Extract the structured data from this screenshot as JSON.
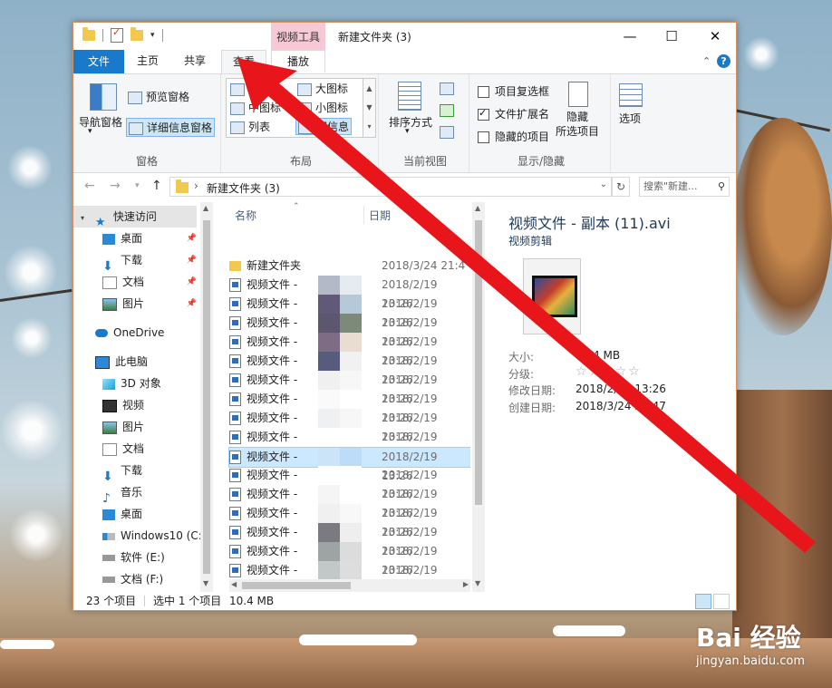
{
  "window": {
    "title": "新建文件夹 (3)",
    "context_tab_header": "视频工具"
  },
  "tabs": [
    {
      "label": "文件"
    },
    {
      "label": "主页"
    },
    {
      "label": "共享"
    },
    {
      "label": "查看"
    },
    {
      "label": "播放"
    }
  ],
  "ribbon": {
    "panes": {
      "nav_pane": "导航窗格",
      "preview_pane": "预览窗格",
      "details_pane": "详细信息窗格",
      "label": "窗格"
    },
    "layout": {
      "items": [
        "超大图标",
        "大图标",
        "中图标",
        "小图标",
        "列表",
        "详细信息"
      ],
      "visible_labels": [
        "超",
        "大图标",
        "中图标",
        "小图标",
        "列表",
        "细信息"
      ],
      "label": "布局"
    },
    "current_view": {
      "sort_by": "排序方式",
      "label": "当前视图"
    },
    "show_hide": {
      "item_checkboxes": "项目复选框",
      "file_extensions": "文件扩展名",
      "hidden_items": "隐藏的项目",
      "hide_selected": "隐藏\n所选项目",
      "hide_selected_1": "隐藏",
      "hide_selected_2": "所选项目",
      "label": "显示/隐藏",
      "file_extensions_checked": true
    },
    "options": "选项"
  },
  "address": {
    "path": "新建文件夹 (3)",
    "search_placeholder": "搜索\"新建..."
  },
  "nav": {
    "quick_access": "快速访问",
    "quick_items": [
      "桌面",
      "下载",
      "文档",
      "图片"
    ],
    "onedrive": "OneDrive",
    "this_pc": "此电脑",
    "pc_items": [
      "3D 对象",
      "视频",
      "图片",
      "文档",
      "下载",
      "音乐",
      "桌面",
      "Windows10 (C:",
      "软件 (E:)",
      "文档 (F:)"
    ]
  },
  "file_list": {
    "col_name": "名称",
    "col_date": "日期",
    "rows": [
      {
        "name": "新建文件夹",
        "date": "2018/3/24 21:4",
        "type": "folder"
      },
      {
        "name": "视频文件 -",
        "date": "2018/2/19 13:26",
        "type": "video"
      },
      {
        "name": "视频文件 -",
        "date": "2018/2/19 13:26",
        "type": "video"
      },
      {
        "name": "视频文件 -",
        "date": "2018/2/19 13:26",
        "type": "video"
      },
      {
        "name": "视频文件 -",
        "date": "2018/2/19 13:26",
        "type": "video"
      },
      {
        "name": "视频文件 -",
        "date": "2018/2/19 13:26",
        "type": "video"
      },
      {
        "name": "视频文件 -",
        "date": "2018/2/19 13:26",
        "type": "video"
      },
      {
        "name": "视频文件 -",
        "date": "2018/2/19 13:26",
        "type": "video"
      },
      {
        "name": "视频文件 -",
        "date": "2018/2/19 13:26",
        "type": "video"
      },
      {
        "name": "视频文件 -",
        "date": "2018/2/19 13:26",
        "type": "video"
      },
      {
        "name": "视频文件 -",
        "date": "2018/2/19 13:26",
        "type": "video",
        "selected": true
      },
      {
        "name": "视频文件 -",
        "date": "2018/2/19 13:26",
        "type": "video"
      },
      {
        "name": "视频文件 -",
        "date": "2018/2/19 13:26",
        "type": "video"
      },
      {
        "name": "视频文件 -",
        "date": "2018/2/19 13:26",
        "type": "video"
      },
      {
        "name": "视频文件 -",
        "date": "2018/2/19 13:26",
        "type": "video"
      },
      {
        "name": "视频文件 -",
        "date": "2018/2/19 13:26",
        "type": "video"
      },
      {
        "name": "视频文件 -",
        "date": "2018/2/19 13:26",
        "type": "video"
      },
      {
        "name": "视频文件 -",
        "date": "2018/2/19 13:26",
        "type": "video"
      }
    ]
  },
  "details": {
    "title": "视频文件 - 副本 (11).avi",
    "subtitle": "视频剪辑",
    "props": [
      {
        "label": "大小:",
        "value": "10.4 MB"
      },
      {
        "label": "分级:",
        "value": "☆☆☆☆☆"
      },
      {
        "label": "修改日期:",
        "value": "2018/2/19 13:26"
      },
      {
        "label": "创建日期:",
        "value": "2018/3/24 21:47"
      }
    ]
  },
  "status": {
    "count": "23 个项目",
    "selected": "选中 1 个项目",
    "size": "10.4 MB"
  },
  "watermark": {
    "brand": "Bai 经验",
    "url": "jingyan.baidu.com"
  },
  "colors": {
    "accent": "#1979ca",
    "annotation_arrow": "#e8151b",
    "selection": "#cce8ff"
  }
}
